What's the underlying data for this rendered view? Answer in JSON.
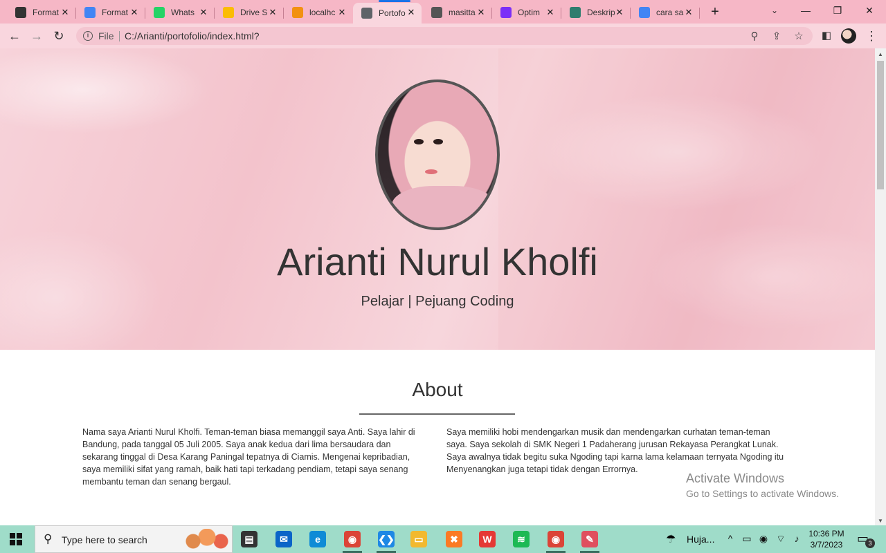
{
  "browser": {
    "tabs": [
      {
        "title": "Format",
        "favicon_color": "#333333",
        "active": false
      },
      {
        "title": "Format",
        "favicon_color": "#4285f4",
        "active": false
      },
      {
        "title": "Whats",
        "favicon_color": "#25d366",
        "active": false
      },
      {
        "title": "Drive S",
        "favicon_color": "#fbbc04",
        "active": false
      },
      {
        "title": "localhc",
        "favicon_color": "#f29111",
        "active": false
      },
      {
        "title": "Portofo",
        "favicon_color": "#5f6368",
        "active": true
      },
      {
        "title": "masitta",
        "favicon_color": "#555555",
        "active": false
      },
      {
        "title": "Optim",
        "favicon_color": "#7b2ff7",
        "active": false
      },
      {
        "title": "Deskrip",
        "favicon_color": "#2e7d6e",
        "active": false
      },
      {
        "title": "cara sa",
        "favicon_color": "#4285f4",
        "active": false
      }
    ],
    "close_glyph": "✕",
    "new_tab_glyph": "+",
    "address": {
      "scheme_label": "File",
      "url": "C:/Arianti/portofolio/index.html?"
    }
  },
  "hero": {
    "name": "Arianti Nurul Kholfi",
    "tagline": "Pelajar | Pejuang Coding"
  },
  "about": {
    "title": "About",
    "col1": "Nama saya Arianti Nurul Kholfi. Teman-teman biasa memanggil saya Anti. Saya lahir di Bandung, pada tanggal 05 Juli 2005. Saya anak kedua dari lima bersaudara dan sekarang tinggal di Desa Karang Paningal tepatnya di Ciamis. Mengenai kepribadian, saya memiliki sifat yang ramah, baik hati tapi terkadang pendiam, tetapi saya senang membantu teman dan senang bergaul.",
    "col2": "Saya memiliki hobi mendengarkan musik dan mendengarkan curhatan teman-teman saya. Saya sekolah di SMK Negeri 1 Padaherang jurusan Rekayasa Perangkat Lunak. Saya awalnya tidak begitu suka Ngoding tapi karna lama kelamaan ternyata Ngoding itu Menyenangkan juga tetapi tidak dengan Errornya."
  },
  "watermark": {
    "line1": "Activate Windows",
    "line2": "Go to Settings to activate Windows."
  },
  "taskbar": {
    "search_placeholder": "Type here to search",
    "weather_text": "Huja...",
    "time": "10:36 PM",
    "date": "3/7/2023",
    "notification_count": "3",
    "apps": [
      {
        "name": "task-view",
        "color": "#333333",
        "glyph": "▤",
        "open": false
      },
      {
        "name": "mail",
        "color": "#0a64c8",
        "glyph": "✉",
        "open": false
      },
      {
        "name": "edge",
        "color": "#0f8bd6",
        "glyph": "e",
        "open": false
      },
      {
        "name": "chrome",
        "color": "#db4437",
        "glyph": "◉",
        "open": true
      },
      {
        "name": "vscode",
        "color": "#1e88e5",
        "glyph": "❮❯",
        "open": true
      },
      {
        "name": "file-explorer",
        "color": "#f2b92f",
        "glyph": "▭",
        "open": false
      },
      {
        "name": "xampp",
        "color": "#fb7a24",
        "glyph": "✖",
        "open": false
      },
      {
        "name": "wps-office",
        "color": "#e53935",
        "glyph": "W",
        "open": false
      },
      {
        "name": "spotify",
        "color": "#1db954",
        "glyph": "≋",
        "open": false
      },
      {
        "name": "chrome-profile",
        "color": "#db4437",
        "glyph": "◉",
        "open": true
      },
      {
        "name": "paint",
        "color": "#e04f5f",
        "glyph": "✎",
        "open": true
      }
    ]
  }
}
